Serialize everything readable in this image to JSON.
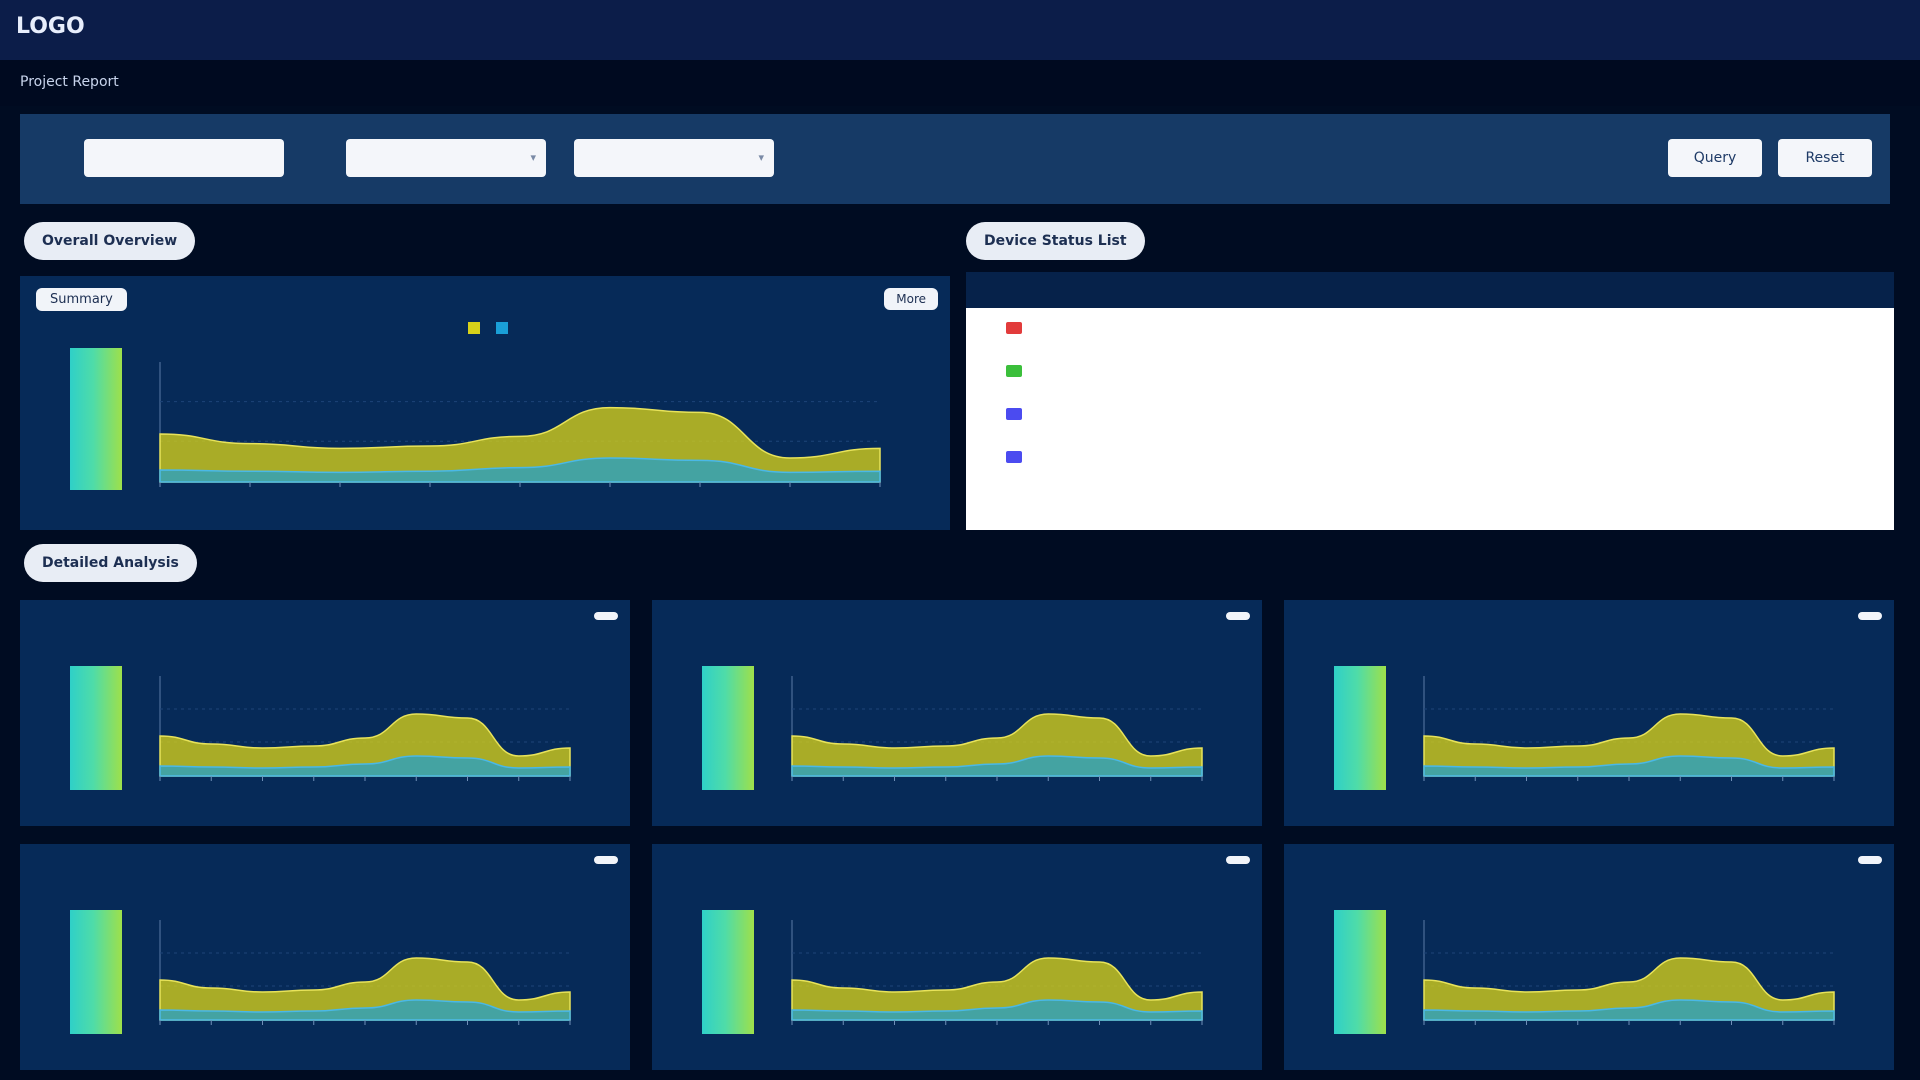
{
  "app": {
    "title": "LOGO"
  },
  "page": {
    "title": "Project Report"
  },
  "filters": {
    "project_label": "",
    "project_value": "",
    "type_label": "",
    "type_value": "",
    "date_value": "",
    "time_label": "",
    "query_button": "Query",
    "reset_button": "Reset"
  },
  "sections": {
    "overview": "Overall Overview",
    "device_list": "Device Status List",
    "details": "Detailed Analysis"
  },
  "colors": {
    "series_a": "#d7d11a",
    "series_b": "#1a9fd7",
    "series_c": "#e1e04a",
    "gauge": "#4fdca8"
  },
  "main_panel": {
    "label": "Summary",
    "badge": "More",
    "legend": [
      {
        "label": "",
        "color": "#d7d11a"
      },
      {
        "label": "",
        "color": "#1a9fd7"
      }
    ],
    "gauge_value": ""
  },
  "panels": [
    {
      "label": "",
      "badge": "",
      "gauge_value": ""
    },
    {
      "label": "",
      "badge": "",
      "gauge_value": ""
    },
    {
      "label": "",
      "badge": "",
      "gauge_value": ""
    },
    {
      "label": "",
      "badge": "",
      "gauge_value": ""
    },
    {
      "label": "",
      "badge": "",
      "gauge_value": ""
    },
    {
      "label": "",
      "badge": "",
      "gauge_value": ""
    }
  ],
  "table": {
    "columns": [
      "",
      "",
      ""
    ],
    "rows": [
      {
        "status": "",
        "status_color": "#e23b3b",
        "time": "",
        "value": ""
      },
      {
        "status": "",
        "status_color": "#3bbf3b",
        "time": "",
        "value": ""
      },
      {
        "status": "",
        "status_color": "#4b4bf0",
        "time": "",
        "value": ""
      },
      {
        "status": "",
        "status_color": "#4b4bf0",
        "time": "",
        "value": ""
      }
    ]
  },
  "chart_data": [
    {
      "type": "area",
      "title": "",
      "x": [
        "",
        "",
        "",
        "",
        "",
        "",
        "",
        "",
        ""
      ],
      "series": [
        {
          "values": [
            40,
            32,
            28,
            30,
            38,
            62,
            58,
            20,
            28
          ]
        },
        {
          "values": [
            10,
            9,
            8,
            9,
            12,
            20,
            18,
            8,
            9
          ]
        }
      ],
      "ylim": [
        0,
        100
      ],
      "y_ticks": [
        "",
        ""
      ]
    },
    {
      "type": "area",
      "x": [
        "",
        "",
        "",
        "",
        "",
        "",
        "",
        "",
        ""
      ],
      "series": [
        {
          "values": [
            40,
            32,
            28,
            30,
            38,
            62,
            58,
            20,
            28
          ]
        },
        {
          "values": [
            10,
            9,
            8,
            9,
            12,
            20,
            18,
            8,
            9
          ]
        }
      ],
      "ylim": [
        0,
        100
      ]
    },
    {
      "type": "area",
      "x": [
        "",
        "",
        "",
        "",
        "",
        "",
        "",
        "",
        ""
      ],
      "series": [
        {
          "values": [
            40,
            32,
            28,
            30,
            38,
            62,
            58,
            20,
            28
          ]
        },
        {
          "values": [
            10,
            9,
            8,
            9,
            12,
            20,
            18,
            8,
            9
          ]
        }
      ],
      "ylim": [
        0,
        100
      ]
    },
    {
      "type": "area",
      "x": [
        "",
        "",
        "",
        "",
        "",
        "",
        "",
        "",
        ""
      ],
      "series": [
        {
          "values": [
            40,
            32,
            28,
            30,
            38,
            62,
            58,
            20,
            28
          ]
        },
        {
          "values": [
            10,
            9,
            8,
            9,
            12,
            20,
            18,
            8,
            9
          ]
        }
      ],
      "ylim": [
        0,
        100
      ]
    },
    {
      "type": "area",
      "x": [
        "",
        "",
        "",
        "",
        "",
        "",
        "",
        "",
        ""
      ],
      "series": [
        {
          "values": [
            40,
            32,
            28,
            30,
            38,
            62,
            58,
            20,
            28
          ]
        },
        {
          "values": [
            10,
            9,
            8,
            9,
            12,
            20,
            18,
            8,
            9
          ]
        }
      ],
      "ylim": [
        0,
        100
      ]
    },
    {
      "type": "area",
      "x": [
        "",
        "",
        "",
        "",
        "",
        "",
        "",
        "",
        ""
      ],
      "series": [
        {
          "values": [
            40,
            32,
            28,
            30,
            38,
            62,
            58,
            20,
            28
          ]
        },
        {
          "values": [
            10,
            9,
            8,
            9,
            12,
            20,
            18,
            8,
            9
          ]
        }
      ],
      "ylim": [
        0,
        100
      ]
    },
    {
      "type": "area",
      "x": [
        "",
        "",
        "",
        "",
        "",
        "",
        "",
        "",
        ""
      ],
      "series": [
        {
          "values": [
            40,
            32,
            28,
            30,
            38,
            62,
            58,
            20,
            28
          ]
        },
        {
          "values": [
            10,
            9,
            8,
            9,
            12,
            20,
            18,
            8,
            9
          ]
        }
      ],
      "ylim": [
        0,
        100
      ]
    }
  ]
}
